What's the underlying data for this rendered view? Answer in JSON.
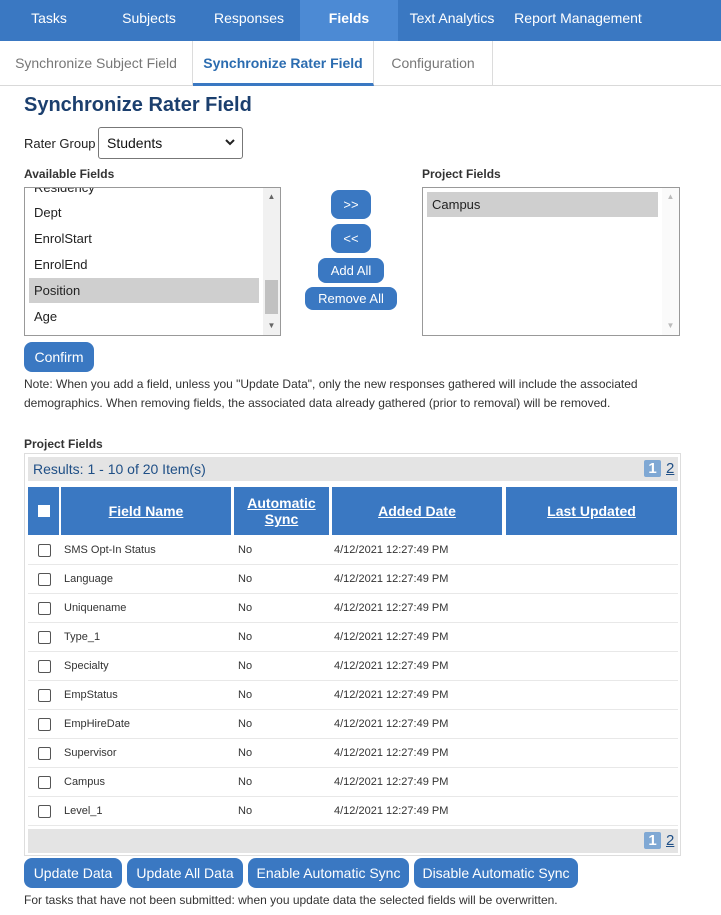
{
  "nav": {
    "items": [
      "Tasks",
      "Subjects",
      "Responses",
      "Fields",
      "Text Analytics",
      "Report Management"
    ],
    "active_index": 3
  },
  "subtabs": {
    "items": [
      "Synchronize Subject Field",
      "Synchronize Rater Field",
      "Configuration"
    ],
    "active_index": 1
  },
  "page": {
    "title": "Synchronize Rater Field",
    "rater_group_label": "Rater Group",
    "rater_group_value": "Students",
    "available_fields_label": "Available Fields",
    "project_fields_label": "Project Fields",
    "available_fields": [
      "Residency",
      "Dept",
      "EnrolStart",
      "EnrolEnd",
      "Position",
      "Age"
    ],
    "available_selected": "Position",
    "project_fields": [
      "Campus"
    ],
    "buttons": {
      "add": ">>",
      "remove": "<<",
      "add_all": "Add All",
      "remove_all": "Remove All",
      "confirm": "Confirm"
    },
    "note": "Note: When you add a field, unless you \"Update Data\", only the new responses gathered will include the associated demographics. When removing fields, the associated data already gathered (prior to removal) will be removed."
  },
  "grid": {
    "section_label": "Project Fields",
    "results_text": "Results: 1 - 10 of 20 Item(s)",
    "pages": [
      "1",
      "2"
    ],
    "columns": [
      "Field Name",
      "Automatic Sync",
      "Added Date",
      "Last Updated"
    ],
    "rows": [
      {
        "name": "SMS Opt-In Status",
        "sync": "No",
        "added": "4/12/2021 12:27:49 PM",
        "updated": ""
      },
      {
        "name": "Language",
        "sync": "No",
        "added": "4/12/2021 12:27:49 PM",
        "updated": ""
      },
      {
        "name": "Uniquename",
        "sync": "No",
        "added": "4/12/2021 12:27:49 PM",
        "updated": ""
      },
      {
        "name": "Type_1",
        "sync": "No",
        "added": "4/12/2021 12:27:49 PM",
        "updated": ""
      },
      {
        "name": "Specialty",
        "sync": "No",
        "added": "4/12/2021 12:27:49 PM",
        "updated": ""
      },
      {
        "name": "EmpStatus",
        "sync": "No",
        "added": "4/12/2021 12:27:49 PM",
        "updated": ""
      },
      {
        "name": "EmpHireDate",
        "sync": "No",
        "added": "4/12/2021 12:27:49 PM",
        "updated": ""
      },
      {
        "name": "Supervisor",
        "sync": "No",
        "added": "4/12/2021 12:27:49 PM",
        "updated": ""
      },
      {
        "name": "Campus",
        "sync": "No",
        "added": "4/12/2021 12:27:49 PM",
        "updated": ""
      },
      {
        "name": "Level_1",
        "sync": "No",
        "added": "4/12/2021 12:27:49 PM",
        "updated": ""
      }
    ]
  },
  "actions": {
    "update_data": "Update Data",
    "update_all_data": "Update All Data",
    "enable_sync": "Enable Automatic Sync",
    "disable_sync": "Disable Automatic Sync"
  },
  "footer_note": "For tasks that have not been submitted: when you update data the selected fields will be overwritten."
}
